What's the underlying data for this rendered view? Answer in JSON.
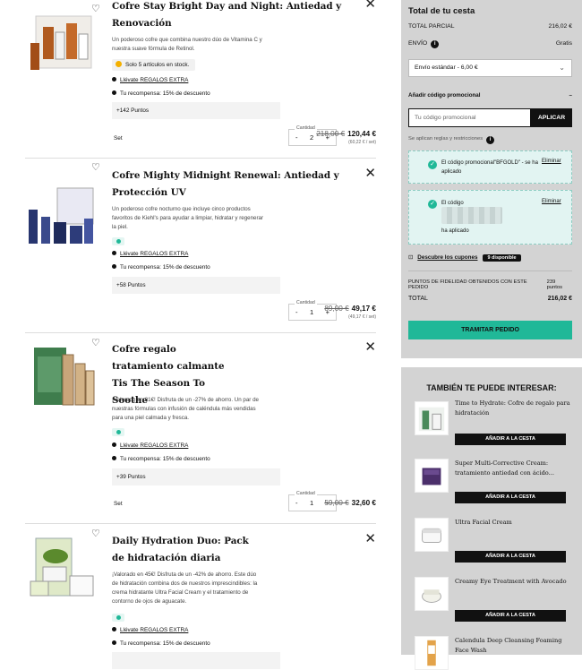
{
  "items": [
    {
      "name": "Cofre Stay Bright Day and Night: Antiedad y Renovación",
      "description": "Un poderoso cofre que combina nuestro dúo de Vitamina C y nuestra suave fórmula de Retinol.",
      "stock": "Solo 5 artículos en stock.",
      "gift_link": "Llévate REGALOS EXTRA",
      "reward": "Tu recompensa: 15% de descuento",
      "points": "+142 Puntos",
      "set_label": "Set",
      "qty_label": "Cantidad",
      "qty": "2",
      "old_price": "218,00 €",
      "price": "120,44 €",
      "unit_price": "(60,22 € / set)"
    },
    {
      "name": "Cofre Mighty Midnight Renewal: Antiedad y Protección UV",
      "description": "Un poderoso cofre nocturno que incluye cinco productos favoritos de Kiehl's para ayudar a limpiar, hidratar y regenerar la piel.",
      "gift_link": "Llévate REGALOS EXTRA",
      "reward": "Tu recompensa: 15% de descuento",
      "points": "+58 Puntos",
      "qty_label": "Cantidad",
      "qty": "1",
      "old_price": "89,00 €",
      "price": "49,17 €",
      "unit_price": "(49,17 € / set)"
    },
    {
      "name": "Cofre regalo tratamiento calmante Tis The Season To Soothe",
      "description": "¡Valorado en 81€! Disfruta de un -27% de ahorro. Un par de nuestras fórmulas con infusión de caléndula más vendidas para una piel calmada y fresca.",
      "gift_link": "Llévate REGALOS EXTRA",
      "reward": "Tu recompensa: 15% de descuento",
      "points": "+39 Puntos",
      "set_label": "Set",
      "qty_label": "Cantidad",
      "qty": "1",
      "old_price": "59,00 €",
      "price": "32,60 €"
    },
    {
      "name": "Daily Hydration Duo: Pack de hidratación diaria",
      "description": "¡Valorado en 45€! Disfruta de un -42% de ahorro. Este dúo de hidratación combina dos de nuestros imprescindibles: la crema hidratante Ultra Facial Cream y el tratamiento de contorno de ojos de aguacate.",
      "gift_link": "Llévate REGALOS EXTRA",
      "reward": "Tu recompensa: 15% de descuento"
    }
  ],
  "summary": {
    "title": "Total de tu cesta",
    "subtotal_label": "TOTAL PARCIAL",
    "subtotal": "216,02 €",
    "shipping_label": "ENVÍO",
    "shipping_value": "Gratis",
    "shipping_option": "Envío estándar - 6,00 €",
    "promo_toggle": "Añadir código promocional",
    "promo_toggle_sign": "–",
    "promo_placeholder": "Tu código promocional",
    "apply": "APLICAR",
    "rules": "Se aplican reglas y restricciones",
    "coupon1_text": "El código promocional\"BFGOLD\" - se ha aplicado",
    "coupon1_remove": "Eliminar",
    "coupon2_text": "El código",
    "coupon2_applied": "ha aplicado",
    "coupon2_remove": "Eliminar",
    "discover": "Descubre los cupones",
    "discover_badge": "9 disponible",
    "loyalty_label": "PUNTOS DE FIDELIDAD OBTENIDOS CON ESTE PEDIDO",
    "loyalty_value": "239 puntos",
    "total_label": "TOTAL",
    "total": "216,02 €",
    "checkout": "TRAMITAR PEDIDO"
  },
  "reco": {
    "title": "TAMBIÉN TE PUEDE INTERESAR:",
    "button": "AÑADIR A LA CESTA",
    "items": [
      {
        "name": "Time to Hydrate: Cofre de regalo para hidratación"
      },
      {
        "name": "Super Multi-Corrective Cream: tratamiento antiedad con ácido..."
      },
      {
        "name": "Ultra Facial Cream"
      },
      {
        "name": "Creamy Eye Treatment with Avocado"
      },
      {
        "name": "Calendula Deep Cleansing Foaming Face Wash"
      }
    ]
  },
  "icons": {
    "heart": "♡",
    "close": "✕",
    "minus": "-",
    "plus": "+",
    "chevron": "⌄",
    "check": "✓",
    "info": "i",
    "ticket": "⊡"
  }
}
